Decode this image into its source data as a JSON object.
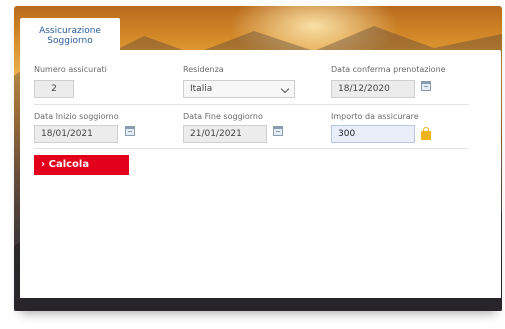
{
  "tab": {
    "title_line1": "Assicurazione",
    "title_line2": "Soggiorno"
  },
  "form": {
    "numero_assicurati": {
      "label": "Numero assicurati",
      "value": "2"
    },
    "residenza": {
      "label": "Residenza",
      "value": "Italia"
    },
    "data_conferma": {
      "label": "Data conferma prenotazione",
      "value": "18/12/2020"
    },
    "data_inizio": {
      "label": "Data Inizio soggiorno",
      "value": "18/01/2021"
    },
    "data_fine": {
      "label": "Data Fine soggiorno",
      "value": "21/01/2021"
    },
    "importo": {
      "label": "Importo da assicurare",
      "value": "300"
    }
  },
  "button": {
    "arrow": "›",
    "label": "Calcola"
  },
  "icons": {
    "calendar": "calendar-icon",
    "dropdown": "chevron-down-icon",
    "lock": "lock-icon"
  },
  "colors": {
    "accent_red": "#e3001b",
    "tab_text": "#2c5d9c",
    "focus_bg": "#e8effb"
  }
}
